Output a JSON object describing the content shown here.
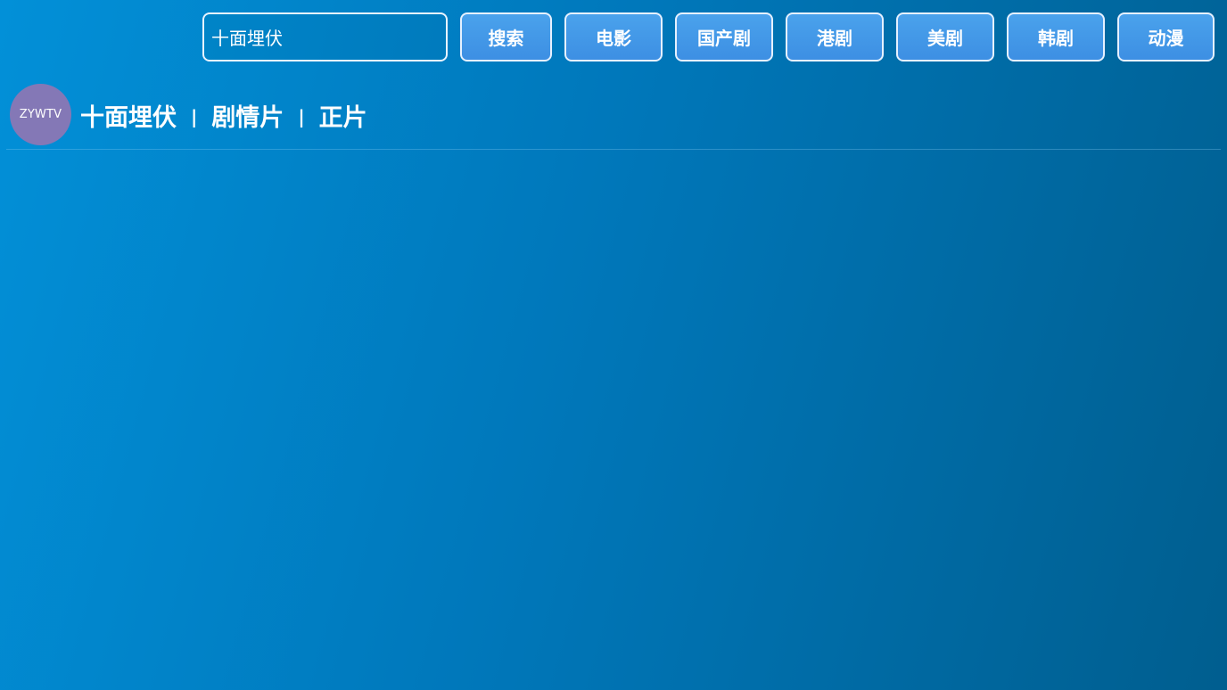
{
  "search": {
    "value": "十面埋伏",
    "button_label": "搜索"
  },
  "categories": [
    {
      "label": "电影"
    },
    {
      "label": "国产剧"
    },
    {
      "label": "港剧"
    },
    {
      "label": "美剧"
    },
    {
      "label": "韩剧"
    },
    {
      "label": "动漫"
    }
  ],
  "results": [
    {
      "avatar_text": "ZYWTV",
      "title": "十面埋伏",
      "separator": "|",
      "genre": "剧情片",
      "status": "正片"
    }
  ],
  "colors": {
    "background_start": "#0290d8",
    "background_end": "#005e8f",
    "button": "#4aa2ec",
    "avatar": "#8478b6"
  }
}
